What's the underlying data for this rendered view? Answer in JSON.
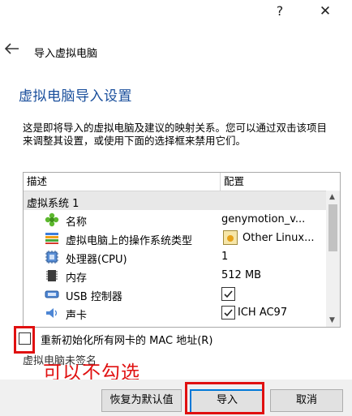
{
  "titlebar": {
    "help": "?",
    "close": "✕"
  },
  "nav": {
    "title": "导入虚拟电脑"
  },
  "section_title": "虚拟电脑导入设置",
  "description": "这是即将导入的虚拟电脑及建议的映射关系。您可以通过双击该项目来调整其设置，或使用下面的选择框来禁用它们。",
  "table": {
    "headers": {
      "description": "描述",
      "config": "配置"
    },
    "group": "虚拟系统 1",
    "rows": [
      {
        "label": "名称",
        "value": "genymotion_v...",
        "icon": "puzzle-icon"
      },
      {
        "label": "虚拟电脑上的操作系统类型",
        "value": "Other Linux...",
        "icon": "os-type-icon"
      },
      {
        "label": "处理器(CPU)",
        "value": "1",
        "icon": "cpu-icon"
      },
      {
        "label": "内存",
        "value": "512 MB",
        "icon": "memory-icon"
      },
      {
        "label": "USB 控制器",
        "value": "",
        "checked": true,
        "icon": "usb-icon"
      },
      {
        "label": "声卡",
        "value": "ICH AC97",
        "checked": true,
        "icon": "sound-icon"
      }
    ]
  },
  "reinit_mac": {
    "label": "重新初始化所有网卡的 MAC 地址(R)",
    "checked": false
  },
  "unsigned_text": "虚拟电脑未签名",
  "annotation": "可以不勾选",
  "buttons": {
    "restore": "恢复为默认值",
    "import": "导入",
    "cancel": "取消"
  },
  "colors": {
    "title_blue": "#1a4f9c",
    "highlight_red": "#e01010",
    "focus_blue": "#0078d7"
  }
}
